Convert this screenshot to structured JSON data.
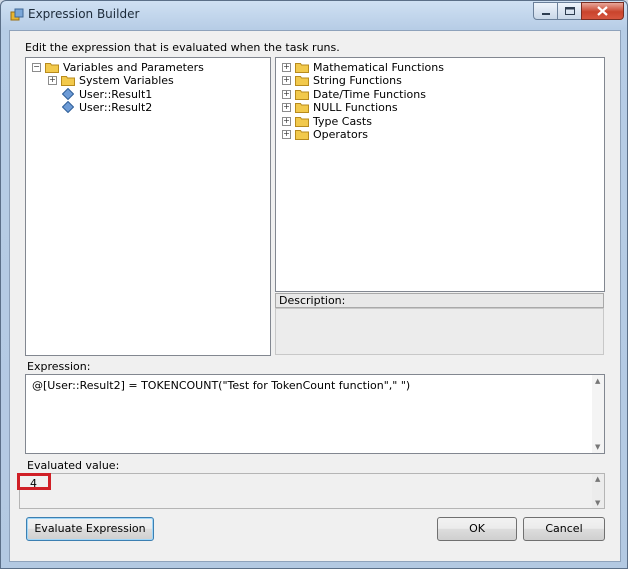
{
  "window": {
    "title": "Expression Builder"
  },
  "instructions": "Edit the expression that is evaluated when the task runs.",
  "variables_tree": {
    "root": "Variables and Parameters",
    "system": "System Variables",
    "vars": [
      "User::Result1",
      "User::Result2"
    ]
  },
  "functions_tree": {
    "items": [
      "Mathematical Functions",
      "String Functions",
      "Date/Time Functions",
      "NULL Functions",
      "Type Casts",
      "Operators"
    ]
  },
  "description": {
    "label": "Description:",
    "text": ""
  },
  "expression": {
    "label": "Expression:",
    "value": "@[User::Result2] =  TOKENCOUNT(\"Test for TokenCount function\",\" \")"
  },
  "evaluated": {
    "label": "Evaluated value:",
    "value": "4"
  },
  "buttons": {
    "evaluate": "Evaluate Expression",
    "ok": "OK",
    "cancel": "Cancel"
  },
  "colors": {
    "highlight": "#d01f26",
    "folder": "#f2c94c"
  },
  "icons": {
    "folder": "folder-icon",
    "variable": "variable-icon",
    "expand": "plus-expander-icon",
    "collapse": "minus-expander-icon"
  }
}
